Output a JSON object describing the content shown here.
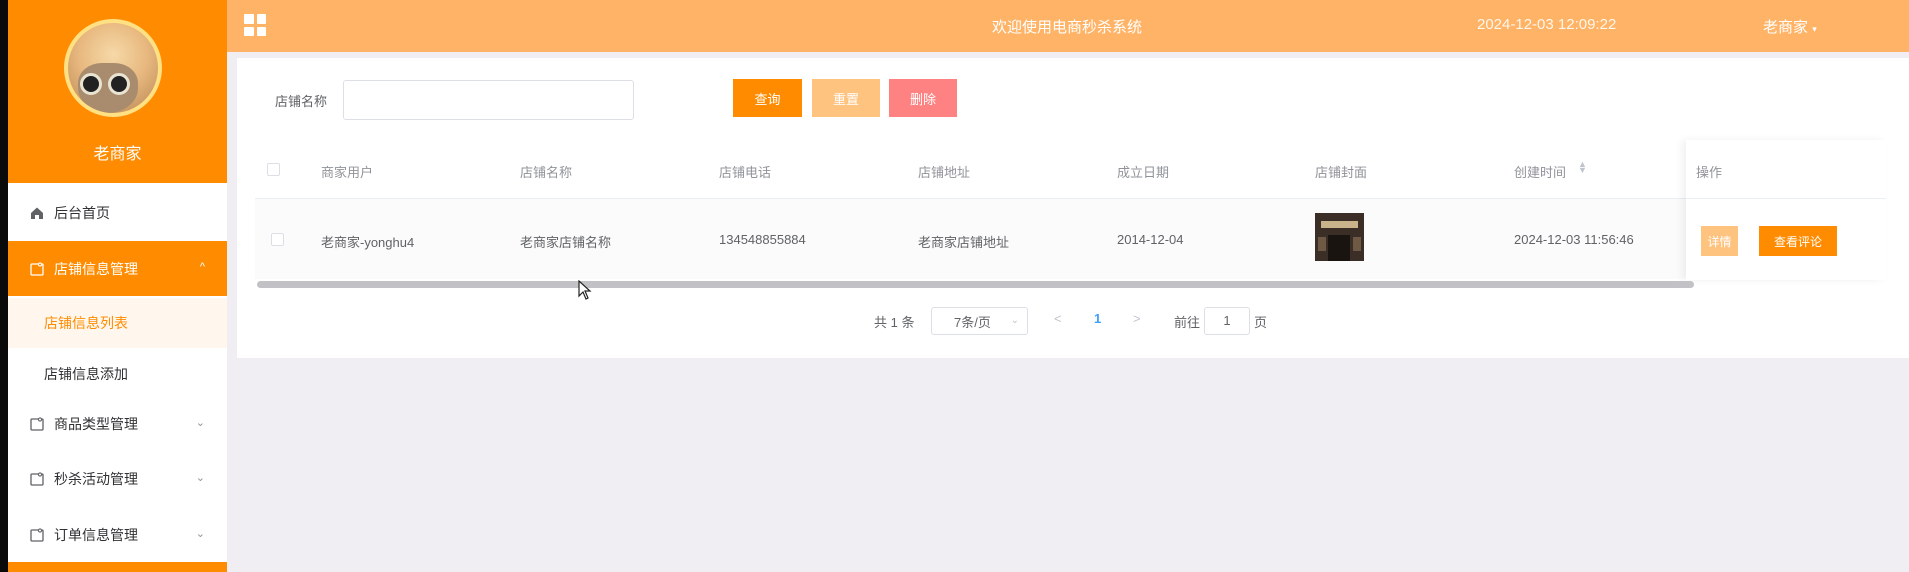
{
  "sidebar": {
    "user_name": "老商家",
    "menu": [
      {
        "label": "后台首页",
        "icon": "home-icon"
      },
      {
        "label": "店铺信息管理",
        "icon": "folder-icon"
      },
      {
        "label": "商品类型管理",
        "icon": "folder-icon"
      },
      {
        "label": "秒杀活动管理",
        "icon": "folder-icon"
      },
      {
        "label": "订单信息管理",
        "icon": "folder-icon"
      }
    ],
    "submenu": [
      {
        "label": "店铺信息列表"
      },
      {
        "label": "店铺信息添加"
      }
    ]
  },
  "topbar": {
    "title": "欢迎使用电商秒杀系统",
    "datetime": "2024-12-03 12:09:22",
    "user": "老商家"
  },
  "search": {
    "label": "店铺名称",
    "value": "",
    "query_label": "查询",
    "reset_label": "重置",
    "delete_label": "删除"
  },
  "table": {
    "headers": [
      "商家用户",
      "店铺名称",
      "店铺电话",
      "店铺地址",
      "成立日期",
      "店铺封面",
      "创建时间",
      "操作"
    ],
    "rows": [
      {
        "user": "老商家-yonghu4",
        "shop_name": "老商家店铺名称",
        "phone": "134548855884",
        "address": "老商家店铺地址",
        "founded": "2014-12-04",
        "created": "2024-12-03 11:56:46",
        "detail_label": "详情",
        "review_label": "查看评论"
      }
    ]
  },
  "pagination": {
    "total": "共 1 条",
    "page_size": "7条/页",
    "current_page": "1",
    "goto_prefix": "前往",
    "goto_value": "1",
    "goto_suffix": "页"
  },
  "colors": {
    "accent": "#ff8c00",
    "topbar": "#ffb366",
    "reset": "#ffc380",
    "delete": "#ff8282",
    "link": "#409eff"
  }
}
